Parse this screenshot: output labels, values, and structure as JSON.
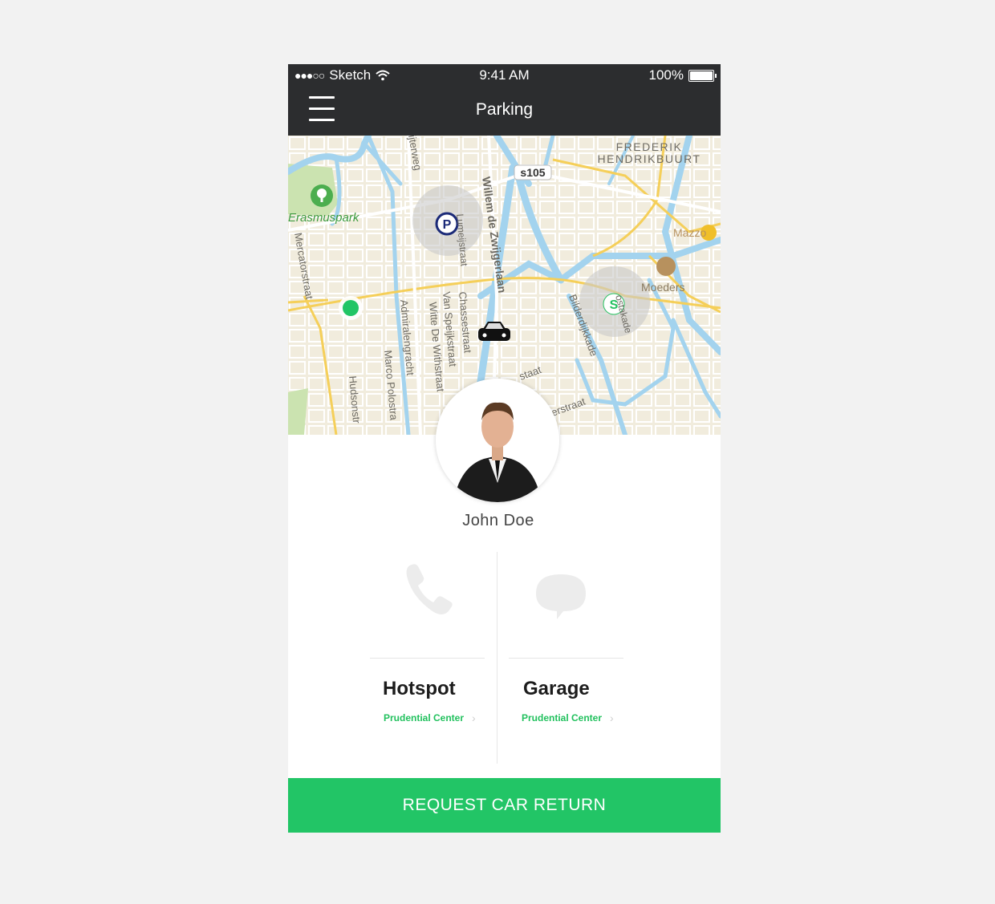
{
  "status_bar": {
    "carrier": "Sketch",
    "signal_dots": "●●●○○",
    "time": "9:41 AM",
    "battery": "100%"
  },
  "nav": {
    "title": "Parking"
  },
  "map": {
    "labels": {
      "district": [
        "FREDERIK",
        "HENDRIKBUURT"
      ],
      "road_badge": "s105",
      "park": "Erasmuspark",
      "restaurant1": "Mazzo",
      "restaurant2": "Moeders",
      "streets": [
        "Mercatorstraat",
        "Admiralengracht",
        "Witte De Withstraat",
        "Van Speijkstraat",
        "Chassestraat",
        "Willem de Zwijgerlaan",
        "Bilderdijkkade",
        "Hudsonstr",
        "Marco Polostra",
        "Lumeijstraat",
        "ijterweg",
        "staat",
        "erstraat",
        "ostakade"
      ]
    },
    "markers": [
      "parking-marker",
      "station-marker",
      "location-dot",
      "car-marker"
    ]
  },
  "profile": {
    "name": "John Doe"
  },
  "options": [
    {
      "title": "Hotspot",
      "subtitle": "Prudential Center",
      "icon": "phone-icon"
    },
    {
      "title": "Garage",
      "subtitle": "Prudential Center",
      "icon": "chat-bubble-icon"
    }
  ],
  "cta": {
    "label": "REQUEST CAR RETURN"
  },
  "colors": {
    "accent": "#22c566",
    "header": "#2c2d2f",
    "subtitle": "#22c15e"
  }
}
